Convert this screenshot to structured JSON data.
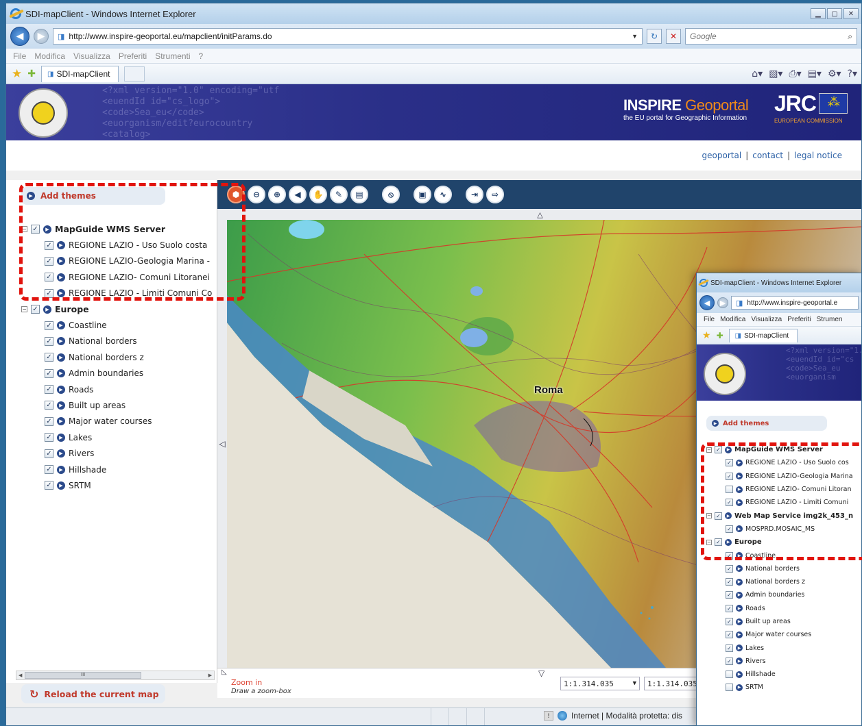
{
  "browser": {
    "title": "SDI-mapClient - Windows Internet Explorer",
    "url": "http://www.inspire-geoportal.eu/mapclient/initParams.do",
    "search_placeholder": "Google",
    "menu": [
      "File",
      "Modifica",
      "Visualizza",
      "Preferiti",
      "Strumenti",
      "?"
    ],
    "tab_title": "SDI-mapClient"
  },
  "banner": {
    "xml_text": "<?xml version=\"1.0\" encoding=\"utf\n<euendId id=\"cs_logo\">\n<code>Sea_eu</code>\n<euorganism/edit?eurocountry\n<catalog>",
    "inspire_word": "INSPIRE",
    "geoportal_word": "Geoportal",
    "inspire_sub": "the EU portal for Geographic Information",
    "jrc": "JRC",
    "commission": "EUROPEAN COMMISSION"
  },
  "header_links": [
    "geoportal",
    "contact",
    "legal notice"
  ],
  "left_panel": {
    "add_themes": "Add themes",
    "reload": "Reload the current map",
    "tree": [
      {
        "label": "MapGuide WMS Server",
        "level": 1,
        "checked": true
      },
      {
        "label": "REGIONE LAZIO - Uso Suolo costa",
        "level": 2,
        "checked": true
      },
      {
        "label": "REGIONE LAZIO-Geologia Marina -",
        "level": 2,
        "checked": true
      },
      {
        "label": "REGIONE LAZIO- Comuni Litoranei",
        "level": 2,
        "checked": true
      },
      {
        "label": "REGIONE LAZIO - Limiti Comuni Co",
        "level": 2,
        "checked": true
      },
      {
        "label": "Europe",
        "level": 1,
        "checked": true
      },
      {
        "label": "Coastline",
        "level": 2,
        "checked": true
      },
      {
        "label": "National borders",
        "level": 2,
        "checked": true
      },
      {
        "label": "National borders z",
        "level": 2,
        "checked": true
      },
      {
        "label": "Admin boundaries",
        "level": 2,
        "checked": true
      },
      {
        "label": "Roads",
        "level": 2,
        "checked": true
      },
      {
        "label": "Built up areas",
        "level": 2,
        "checked": true
      },
      {
        "label": "Major water courses",
        "level": 2,
        "checked": true
      },
      {
        "label": "Lakes",
        "level": 2,
        "checked": true
      },
      {
        "label": "Rivers",
        "level": 2,
        "checked": true
      },
      {
        "label": "Hillshade",
        "level": 2,
        "checked": true
      },
      {
        "label": "SRTM",
        "level": 2,
        "checked": true
      }
    ],
    "scrollbar_thumb": "III"
  },
  "map": {
    "city_label": "Roma",
    "tool_names": [
      "home-tool",
      "zoom-out-tool",
      "zoom-in-tool",
      "back-tool",
      "pan-tool",
      "measure-tool",
      "layers-tool",
      "identify-tool",
      "print-tool",
      "chart-tool",
      "export-tool",
      "forward-tool"
    ],
    "tool_glyphs": [
      "⬢",
      "⊖",
      "⊕",
      "◀",
      "✋",
      "✎",
      "▤",
      "⦸",
      "▣",
      "∿",
      "⇥",
      "⇨"
    ],
    "mode": "Zoom in",
    "hint": "Draw a zoom-box",
    "scale_value": "1:1.314.035",
    "scale_value2": "1:1.314.035"
  },
  "status": {
    "zone": "Internet | Modalità protetta: dis"
  },
  "secondary": {
    "title": "SDI-mapClient - Windows Internet Explorer",
    "url": "http://www.inspire-geoportal.e",
    "menu": [
      "File",
      "Modifica",
      "Visualizza",
      "Preferiti",
      "Strumen"
    ],
    "tab_title": "SDI-mapClient",
    "xml_text": "<?xml version=\"1.0\"\n<euendId id=\"cs\n<code>Sea_eu\n<euorganism",
    "add_themes": "Add themes",
    "tree": [
      {
        "label": "MapGuide WMS Server",
        "level": 1,
        "checked": true
      },
      {
        "label": "REGIONE LAZIO - Uso Suolo cos",
        "level": 2,
        "checked": true
      },
      {
        "label": "REGIONE LAZIO-Geologia Marina",
        "level": 2,
        "checked": true
      },
      {
        "label": "REGIONE LAZIO- Comuni Litoran",
        "level": 2,
        "checked": false
      },
      {
        "label": "REGIONE LAZIO - Limiti Comuni",
        "level": 2,
        "checked": true
      },
      {
        "label": "Web Map Service img2k_453_n",
        "level": 1,
        "checked": true
      },
      {
        "label": "MOSPRD.MOSAIC_MS",
        "level": 2,
        "checked": true
      },
      {
        "label": "Europe",
        "level": 1,
        "checked": true
      },
      {
        "label": "Coastline",
        "level": 2,
        "checked": true
      },
      {
        "label": "National borders",
        "level": 2,
        "checked": true
      },
      {
        "label": "National borders z",
        "level": 2,
        "checked": true
      },
      {
        "label": "Admin boundaries",
        "level": 2,
        "checked": true
      },
      {
        "label": "Roads",
        "level": 2,
        "checked": true
      },
      {
        "label": "Built up areas",
        "level": 2,
        "checked": true
      },
      {
        "label": "Major water courses",
        "level": 2,
        "checked": true
      },
      {
        "label": "Lakes",
        "level": 2,
        "checked": true
      },
      {
        "label": "Rivers",
        "level": 2,
        "checked": true
      },
      {
        "label": "Hillshade",
        "level": 2,
        "checked": false
      },
      {
        "label": "SRTM",
        "level": 2,
        "checked": false
      }
    ]
  },
  "colors": {
    "highlight_dash": "#e1140e",
    "accent_red": "#c0392b",
    "toolbar_bg": "#20446b",
    "banner_bg": "#2a2f88"
  }
}
